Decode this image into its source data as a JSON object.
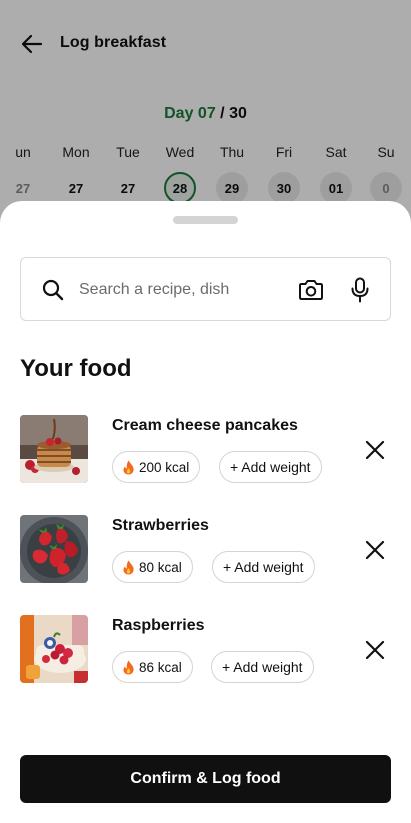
{
  "header": {
    "title": "Log breakfast"
  },
  "day_counter": {
    "prefix": "Day",
    "current": "07",
    "separator": "/",
    "total": "30"
  },
  "week": {
    "days": [
      "un",
      "Mon",
      "Tue",
      "Wed",
      "Thu",
      "Fri",
      "Sat",
      "Su"
    ],
    "dates": [
      "27",
      "27",
      "27",
      "28",
      "29",
      "30",
      "01",
      "0"
    ],
    "active_index": 3
  },
  "search": {
    "placeholder": "Search a recipe, dish",
    "value": ""
  },
  "section": {
    "title": "Your food"
  },
  "foods": [
    {
      "name": "Cream cheese pancakes",
      "kcal": "200 kcal",
      "weight_label": "+ Add weight"
    },
    {
      "name": "Strawberries",
      "kcal": "80 kcal",
      "weight_label": "+ Add weight"
    },
    {
      "name": "Raspberries",
      "kcal": "86 kcal",
      "weight_label": "+ Add weight"
    }
  ],
  "actions": {
    "confirm_label": "Confirm & Log food"
  },
  "colors": {
    "accent_green": "#1e7b3a",
    "button_dark": "#101010",
    "flame": "#f26b1d"
  }
}
